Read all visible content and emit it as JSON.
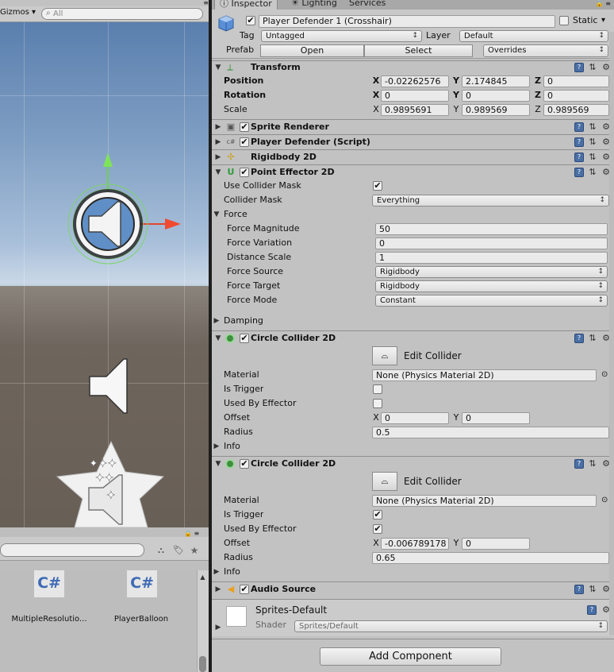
{
  "scene_view": {
    "gizmos_label": "Gizmos",
    "search_placeholder": "All"
  },
  "project": {
    "assets": [
      {
        "icon": "C#",
        "label": "MultipleResolutio..."
      },
      {
        "icon": "C#",
        "label": "PlayerBalloon"
      }
    ]
  },
  "tabs": {
    "inspector": "Inspector",
    "lighting": "Lighting",
    "services": "Services"
  },
  "header": {
    "object_name": "Player Defender 1 (Crosshair)",
    "static_label": "Static",
    "tag_label": "Tag",
    "tag_value": "Untagged",
    "layer_label": "Layer",
    "layer_value": "Default",
    "prefab_label": "Prefab",
    "open_label": "Open",
    "select_label": "Select",
    "overrides_label": "Overrides"
  },
  "transform": {
    "title": "Transform",
    "position_label": "Position",
    "rotation_label": "Rotation",
    "scale_label": "Scale",
    "x": "X",
    "y": "Y",
    "z": "Z",
    "position": [
      "-0.02262576",
      "2.174845",
      "0"
    ],
    "rotation": [
      "0",
      "0",
      "0"
    ],
    "scale": [
      "0.9895691",
      "0.989569",
      "0.989569"
    ]
  },
  "components": {
    "sprite_renderer": "Sprite Renderer",
    "player_defender": "Player Defender (Script)",
    "rigidbody": "Rigidbody 2D",
    "point_effector": "Point Effector 2D",
    "audio_source": "Audio Source"
  },
  "point_effector": {
    "use_collider_mask_label": "Use Collider Mask",
    "use_collider_mask": true,
    "collider_mask_label": "Collider Mask",
    "collider_mask": "Everything",
    "force_label": "Force",
    "force_magnitude_label": "Force Magnitude",
    "force_magnitude": "50",
    "force_variation_label": "Force Variation",
    "force_variation": "0",
    "distance_scale_label": "Distance Scale",
    "distance_scale": "1",
    "force_source_label": "Force Source",
    "force_source": "Rigidbody",
    "force_target_label": "Force Target",
    "force_target": "Rigidbody",
    "force_mode_label": "Force Mode",
    "force_mode": "Constant",
    "damping_label": "Damping"
  },
  "circle_collider_1": {
    "title": "Circle Collider 2D",
    "edit_collider": "Edit Collider",
    "material_label": "Material",
    "material": "None (Physics Material 2D)",
    "is_trigger_label": "Is Trigger",
    "is_trigger": false,
    "used_by_effector_label": "Used By Effector",
    "used_by_effector": false,
    "offset_label": "Offset",
    "offset": [
      "0",
      "0"
    ],
    "radius_label": "Radius",
    "radius": "0.5",
    "info_label": "Info"
  },
  "circle_collider_2": {
    "title": "Circle Collider 2D",
    "edit_collider": "Edit Collider",
    "material_label": "Material",
    "material": "None (Physics Material 2D)",
    "is_trigger_label": "Is Trigger",
    "is_trigger": true,
    "used_by_effector_label": "Used By Effector",
    "used_by_effector": true,
    "offset_label": "Offset",
    "offset": [
      "-0.006789178",
      "0"
    ],
    "radius_label": "Radius",
    "radius": "0.65",
    "info_label": "Info"
  },
  "material_section": {
    "name": "Sprites-Default",
    "shader_label": "Shader",
    "shader": "Sprites/Default"
  },
  "add_component": "Add Component",
  "checkmark": "✔"
}
